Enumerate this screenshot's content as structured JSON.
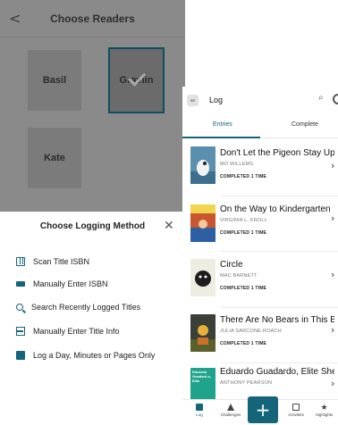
{
  "left": {
    "header": {
      "title": "Choose Readers",
      "back_glyph": "<"
    },
    "readers": [
      {
        "name": "Basil",
        "selected": false
      },
      {
        "name": "Gravlin",
        "selected": true
      },
      {
        "name": "Kate",
        "selected": false
      }
    ],
    "sheet": {
      "title": "Choose Logging Method",
      "close_glyph": "✕",
      "methods": [
        {
          "label": "Scan Title ISBN",
          "icon": "scan-isbn-icon"
        },
        {
          "label": "Manually Enter ISBN",
          "icon": "keyboard-icon"
        },
        {
          "label": "Search Recently Logged Titles",
          "icon": "search-icon"
        },
        {
          "label": "Manually Enter Title Info",
          "icon": "table-icon"
        },
        {
          "label": "Log a Day, Minutes or Pages Only",
          "icon": "books-icon"
        }
      ]
    }
  },
  "right": {
    "header": {
      "avatar_text": "ax",
      "title": "Log",
      "search_glyph": "⌕"
    },
    "tabs": [
      {
        "label": "Entries",
        "active": true
      },
      {
        "label": "Complete",
        "active": false
      }
    ],
    "books": [
      {
        "title": "Don't Let the Pigeon Stay Up L...",
        "author": "MO WILLEMS",
        "status": "COMPLETED 1 TIME",
        "cover_color": "#5a8fb0"
      },
      {
        "title": "On the Way to Kindergarten",
        "author": "VIRGINIA L. KROLL",
        "status": "COMPLETED 1 TIME",
        "cover_color": "#c8572f"
      },
      {
        "title": "Circle",
        "author": "MAC BARNETT",
        "status": "COMPLETED 1 TIME",
        "cover_color": "#efece2"
      },
      {
        "title": "There Are No Bears in This Ba...",
        "author": "JULIA SARCONE-ROACH",
        "status": "COMPLETED 1 TIME",
        "cover_color": "#3a3f37"
      },
      {
        "title": "Eduardo Guadardo, Elite Sheep",
        "author": "ANTHONY PEARSON",
        "status": "",
        "cover_color": "#1fa38c",
        "cover_text": "Eduardo Guadard o, Elite"
      }
    ],
    "nav": [
      {
        "label": "Log",
        "icon": "log-icon"
      },
      {
        "label": "Challenges",
        "icon": "challenges-icon"
      },
      {
        "label": "+",
        "icon": "add-icon"
      },
      {
        "label": "Activities",
        "icon": "activities-icon"
      },
      {
        "label": "Highlights",
        "icon": "star-icon"
      }
    ]
  }
}
